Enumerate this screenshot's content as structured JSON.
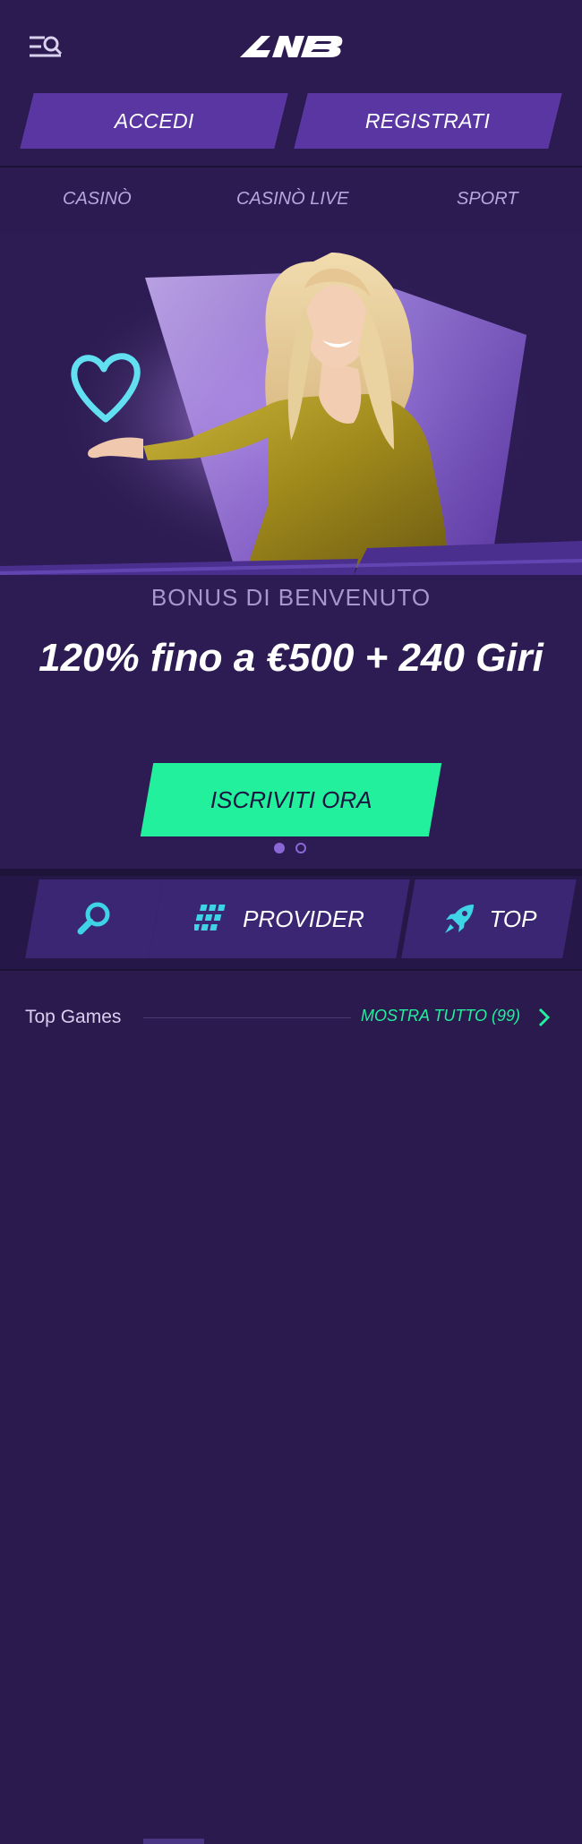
{
  "header": {
    "menu_icon": "menu-search-icon",
    "logo_text": "NB"
  },
  "auth": {
    "login_label": "ACCEDI",
    "register_label": "REGISTRATI"
  },
  "categories": [
    "CASINÒ",
    "CASINÒ LIVE",
    "SPORT"
  ],
  "hero": {
    "subtitle": "BONUS DI BENVENUTO",
    "title": "120% fino a €500 + 240 Giri",
    "cta_label": "ISCRIVITI ORA",
    "slides_total": 2,
    "active_slide": 1
  },
  "toolbar": {
    "search_icon": "search-icon",
    "provider_label": "PROVIDER",
    "provider_icon": "grid-icon",
    "top_label": "TOP",
    "top_icon": "rocket-icon"
  },
  "section": {
    "title": "Top Games",
    "see_all_label": "MOSTRA TUTTO (99)"
  },
  "colors": {
    "background": "#2a1a4e",
    "button": "#5a36a3",
    "accent_green": "#22f09d",
    "icon_cyan": "#3fd3e6"
  }
}
